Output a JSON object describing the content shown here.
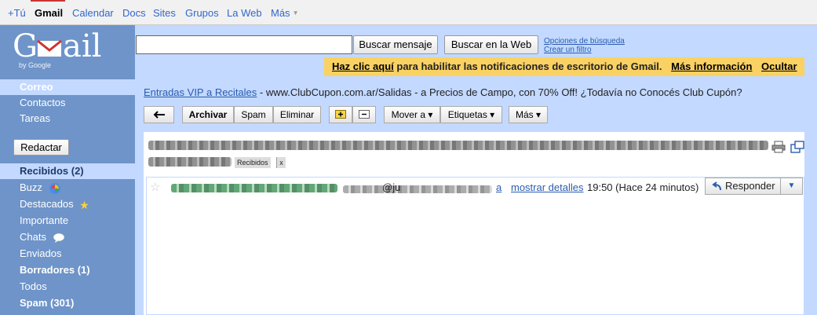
{
  "gbar": {
    "items": [
      "+Tú",
      "Gmail",
      "Calendar",
      "Docs",
      "Sites",
      "Grupos",
      "La Web",
      "Más"
    ],
    "active": "Gmail"
  },
  "logo": {
    "text": "GMail",
    "byline": "by Google"
  },
  "search": {
    "input_value": "",
    "mail_button": "Buscar mensaje",
    "web_button": "Buscar en la Web",
    "options_link": "Opciones de búsqueda",
    "filter_link": "Crear un filtro"
  },
  "notification": {
    "link": "Haz clic aquí",
    "text": "para habilitar las notificaciones de escritorio de Gmail.",
    "more": "Más información",
    "hide": "Ocultar",
    "color": "#fad163"
  },
  "sidebar": {
    "sections": [
      "Correo",
      "Contactos",
      "Tareas"
    ],
    "compose": "Redactar",
    "folders": [
      {
        "label": "Recibidos (2)",
        "bold": true,
        "selected": true
      },
      {
        "label": "Buzz",
        "icon": "buzz-icon"
      },
      {
        "label": "Destacados",
        "icon": "star-icon"
      },
      {
        "label": "Importante"
      },
      {
        "label": "Chats",
        "icon": "chat-bubble-icon"
      },
      {
        "label": "Enviados"
      },
      {
        "label": "Borradores (1)",
        "bold": true
      },
      {
        "label": "Todos"
      },
      {
        "label": "Spam (301)",
        "bold": true
      }
    ]
  },
  "webclip": {
    "link": "Entradas VIP a Recitales",
    "text": "- www.ClubCupon.com.ar/Salidas - a Precios de Campo, con 70% Off! ¿Todavía no Conocés Club Cupón?"
  },
  "toolbar": {
    "back": "back-arrow-icon",
    "archive": "Archivar",
    "spam": "Spam",
    "delete": "Eliminar",
    "move": "Mover a ▾",
    "labels": "Etiquetas ▾",
    "more": "Más ▾"
  },
  "message": {
    "subject_label": "Recibidos",
    "subject_label_close": "x",
    "at_sign": "@ju",
    "a_link": "a",
    "details_link": "mostrar detalles",
    "timestamp": "19:50 (Hace 24 minutos)",
    "reply": "Responder"
  },
  "colors": {
    "sidebar": "#6e94c9",
    "light_blue": "#c3d9ff",
    "link": "#2a5db0",
    "sender": "#006633"
  }
}
